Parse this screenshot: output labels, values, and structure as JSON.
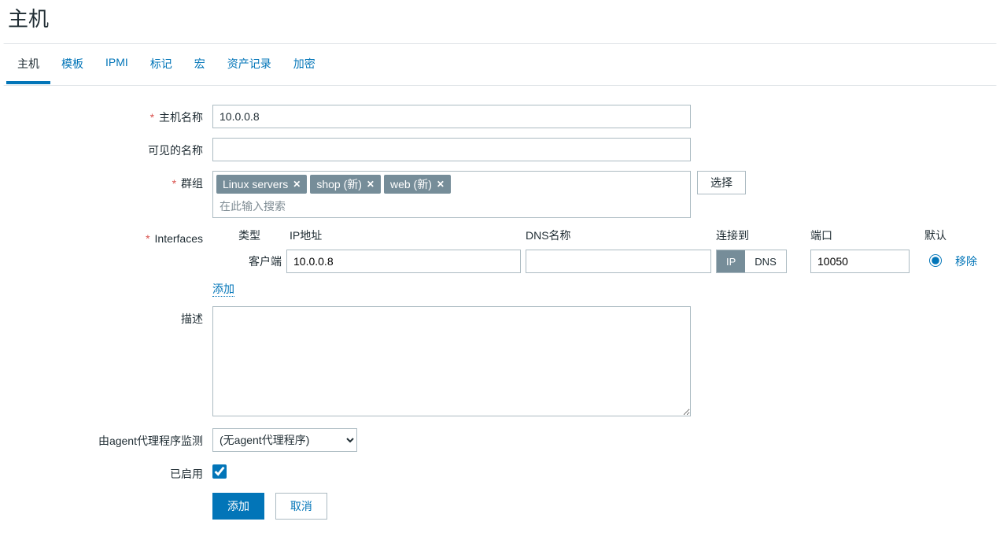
{
  "page_title": "主机",
  "tabs": [
    "主机",
    "模板",
    "IPMI",
    "标记",
    "宏",
    "资产记录",
    "加密"
  ],
  "labels": {
    "hostname": "主机名称",
    "visible_name": "可见的名称",
    "groups": "群组",
    "interfaces": "Interfaces",
    "description": "描述",
    "proxy": "由agent代理程序监测",
    "enabled": "已启用"
  },
  "values": {
    "hostname": "10.0.0.8",
    "visible_name": ""
  },
  "groups": {
    "tags": [
      "Linux servers",
      "shop (新)",
      "web (新)"
    ],
    "placeholder": "在此输入搜索",
    "select_btn": "选择"
  },
  "interfaces": {
    "headers": {
      "type": "类型",
      "ip": "IP地址",
      "dns": "DNS名称",
      "conn": "连接到",
      "port": "端口",
      "def": "默认"
    },
    "row": {
      "type_label": "客户端",
      "ip": "10.0.0.8",
      "dns": "",
      "conn_ip": "IP",
      "conn_dns": "DNS",
      "port": "10050",
      "remove": "移除"
    },
    "add_link": "添加"
  },
  "proxy": {
    "selected": "(无agent代理程序)"
  },
  "buttons": {
    "submit": "添加",
    "cancel": "取消"
  }
}
